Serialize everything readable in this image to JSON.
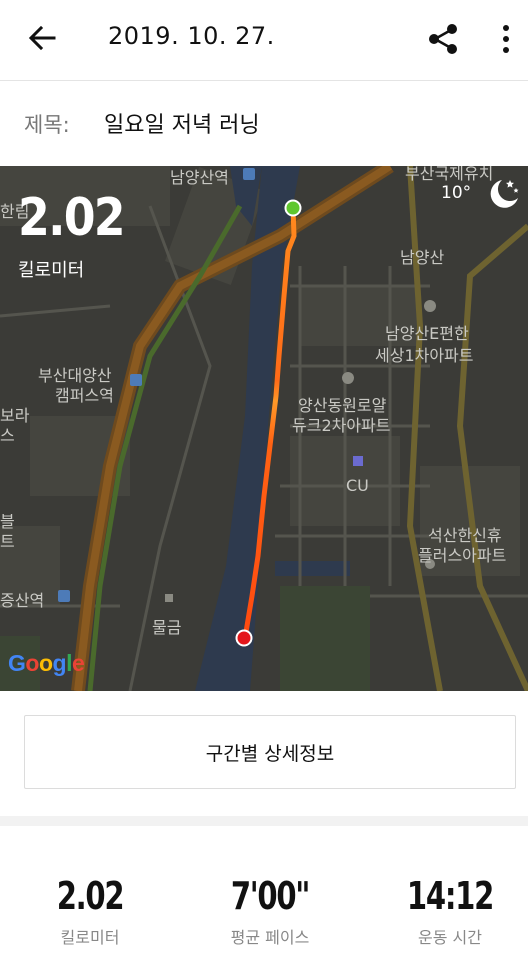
{
  "header": {
    "date": "2019. 10. 27.",
    "back_icon": "arrow-left-icon",
    "share_icon": "share-icon",
    "more_icon": "more-vertical-icon"
  },
  "title_row": {
    "label": "제목:",
    "value": "일요일 저녁 러닝"
  },
  "map": {
    "distance": "2.02",
    "distance_unit": "킬로미터",
    "temperature": "10°",
    "weather_icon": "moon-stars-icon",
    "route_color": "#ff5a14",
    "start_color": "#5fc72e",
    "end_color": "#e4161b",
    "labels": {
      "namyang_station": "남양산역",
      "busan_univ_top": "부산국제유치",
      "hanrim": "한림",
      "namyangsan": "남양산",
      "apt1_a": "남양산E편한",
      "apt1_b": "세상1차아파트",
      "busan_campus_a": "부산대양산",
      "busan_campus_b": "캠퍼스역",
      "bora_a": "보라",
      "bora_b": "스",
      "apt2_a": "양산동원로얄",
      "apt2_b": "듀크2차아파트",
      "cu": "CU",
      "beul_a": "블",
      "beul_b": "트",
      "apt3_a": "석산한신휴",
      "apt3_b": "플러스아파트",
      "jeungsan": "증산역",
      "mulgeum": "물금"
    },
    "attribution": "Google"
  },
  "section_button": "구간별 상세정보",
  "stats": [
    {
      "value": "2.02",
      "label": "킬로미터"
    },
    {
      "value": "7'00\"",
      "label": "평균 페이스"
    },
    {
      "value": "14:12",
      "label": "운동 시간"
    }
  ]
}
